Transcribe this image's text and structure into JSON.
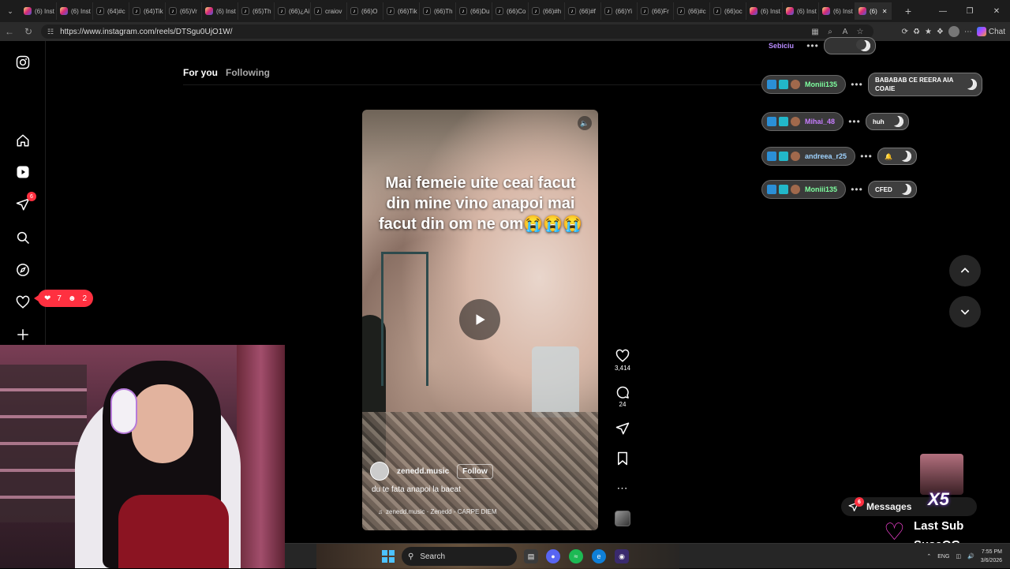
{
  "browser": {
    "tabs": [
      {
        "icon": "ig",
        "label": "(6) Inst"
      },
      {
        "icon": "ig",
        "label": "(6) Inst"
      },
      {
        "icon": "tt",
        "label": "(64)#c"
      },
      {
        "icon": "tt",
        "label": "(64)Tik"
      },
      {
        "icon": "tt",
        "label": "(65)Vr"
      },
      {
        "icon": "ig",
        "label": "(6) Inst"
      },
      {
        "icon": "tt",
        "label": "(65)Th"
      },
      {
        "icon": "tt",
        "label": "(66)¿Ai"
      },
      {
        "icon": "tt",
        "label": "craiov"
      },
      {
        "icon": "tt",
        "label": "(66)O"
      },
      {
        "icon": "tt",
        "label": "(66)Tik"
      },
      {
        "icon": "tt",
        "label": "(66)Th"
      },
      {
        "icon": "tt",
        "label": "(66)Du"
      },
      {
        "icon": "tt",
        "label": "(66)Co"
      },
      {
        "icon": "tt",
        "label": "(66)#h"
      },
      {
        "icon": "tt",
        "label": "(66)#f"
      },
      {
        "icon": "tt",
        "label": "(66)Yi"
      },
      {
        "icon": "tt",
        "label": "(66)Fr"
      },
      {
        "icon": "tt",
        "label": "(66)#c"
      },
      {
        "icon": "tt",
        "label": "(66)oc"
      },
      {
        "icon": "ig",
        "label": "(6) Inst"
      },
      {
        "icon": "ig",
        "label": "(6) Inst"
      },
      {
        "icon": "ig",
        "label": "(6) Inst"
      },
      {
        "icon": "ig",
        "label": "(6)"
      }
    ],
    "url": "https://www.instagram.com/reels/DTSgu0UjO1W/",
    "copilot_label": "Chat"
  },
  "feed": {
    "tab_for_you": "For you",
    "tab_following": "Following"
  },
  "sidenav": {
    "notifications_badge": "6",
    "notif_likes": "7",
    "notif_follows": "2"
  },
  "reel": {
    "caption": "Mai femeie uite ceai facut din mine vino anapoi mai facut din om ne om😭😭😭",
    "author": "zenedd.music",
    "follow_label": "Follow",
    "description": "du te fata anapoi la baeat",
    "audio": "zenedd.music · Zenedd - CARPE DIEM",
    "likes": "3,414",
    "comments": "24"
  },
  "chat": [
    {
      "name": "Sebiciu",
      "name_color": "#b98cff",
      "message": "",
      "partial": true
    },
    {
      "name": "Moniii135",
      "name_color": "#7fffa0",
      "message": "BABABAB CE REERA AIA COAIE"
    },
    {
      "name": "Mihai_48",
      "name_color": "#c77dff",
      "message": "huh"
    },
    {
      "name": "andreea_r25",
      "name_color": "#9fd3ff",
      "message": "🔔"
    },
    {
      "name": "Moniii135",
      "name_color": "#7fffa0",
      "message": "CFED"
    }
  ],
  "messages": {
    "label": "Messages",
    "badge": "6"
  },
  "stream": {
    "multiplier": "X5",
    "last_sub_label": "Last Sub",
    "last_sub_name": "SusaOG"
  },
  "taskbar": {
    "search_label": "Search",
    "lang": "ENG",
    "time": "7:55 PM",
    "date": "3/6/2026"
  }
}
